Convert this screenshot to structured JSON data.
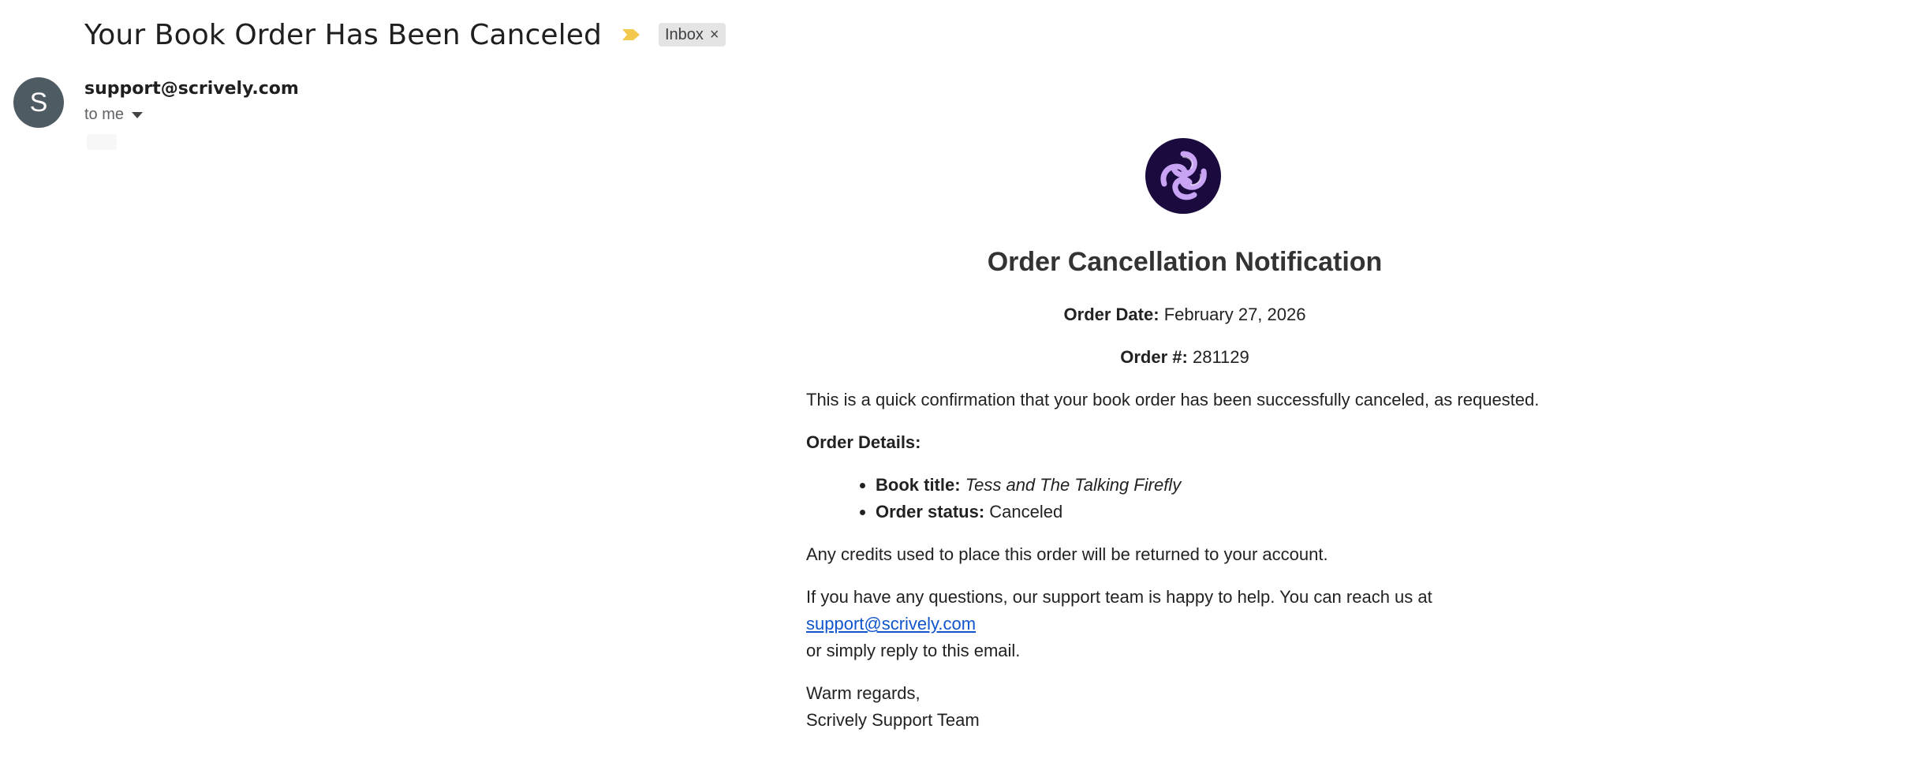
{
  "header": {
    "subject": "Your Book Order Has Been Canceled",
    "label": "Inbox",
    "label_close": "×",
    "importance_color": "#f2c94c"
  },
  "sender": {
    "avatar_letter": "S",
    "avatar_color": "#4f5b62",
    "email": "support@scrively.com",
    "recipient": "to me"
  },
  "body": {
    "heading": "Order Cancellation Notification",
    "order_date_label": "Order Date:",
    "order_date_value": "February 27, 2026",
    "order_number_label": "Order #:",
    "order_number_value": "281129",
    "intro": "This is a quick confirmation that your book order has been successfully canceled, as requested.",
    "details_heading": "Order Details:",
    "details": [
      {
        "label": "Book title:",
        "value": "Tess and The Talking Firefly"
      },
      {
        "label": "Order status:",
        "value": "Canceled"
      }
    ],
    "credits": "Any credits used to place this order will be returned to your account.",
    "questions_prefix": "If you have any questions, our support team is happy to help. You can reach us at ",
    "support_link": "support@scrively.com",
    "questions_suffix": "or simply reply to this email.",
    "regards": "Warm regards,",
    "signature": "Scrively Support Team",
    "link_color": "#1155cc",
    "logo_bg": "#1a0a3d",
    "logo_accent": "#c9a4f5"
  }
}
